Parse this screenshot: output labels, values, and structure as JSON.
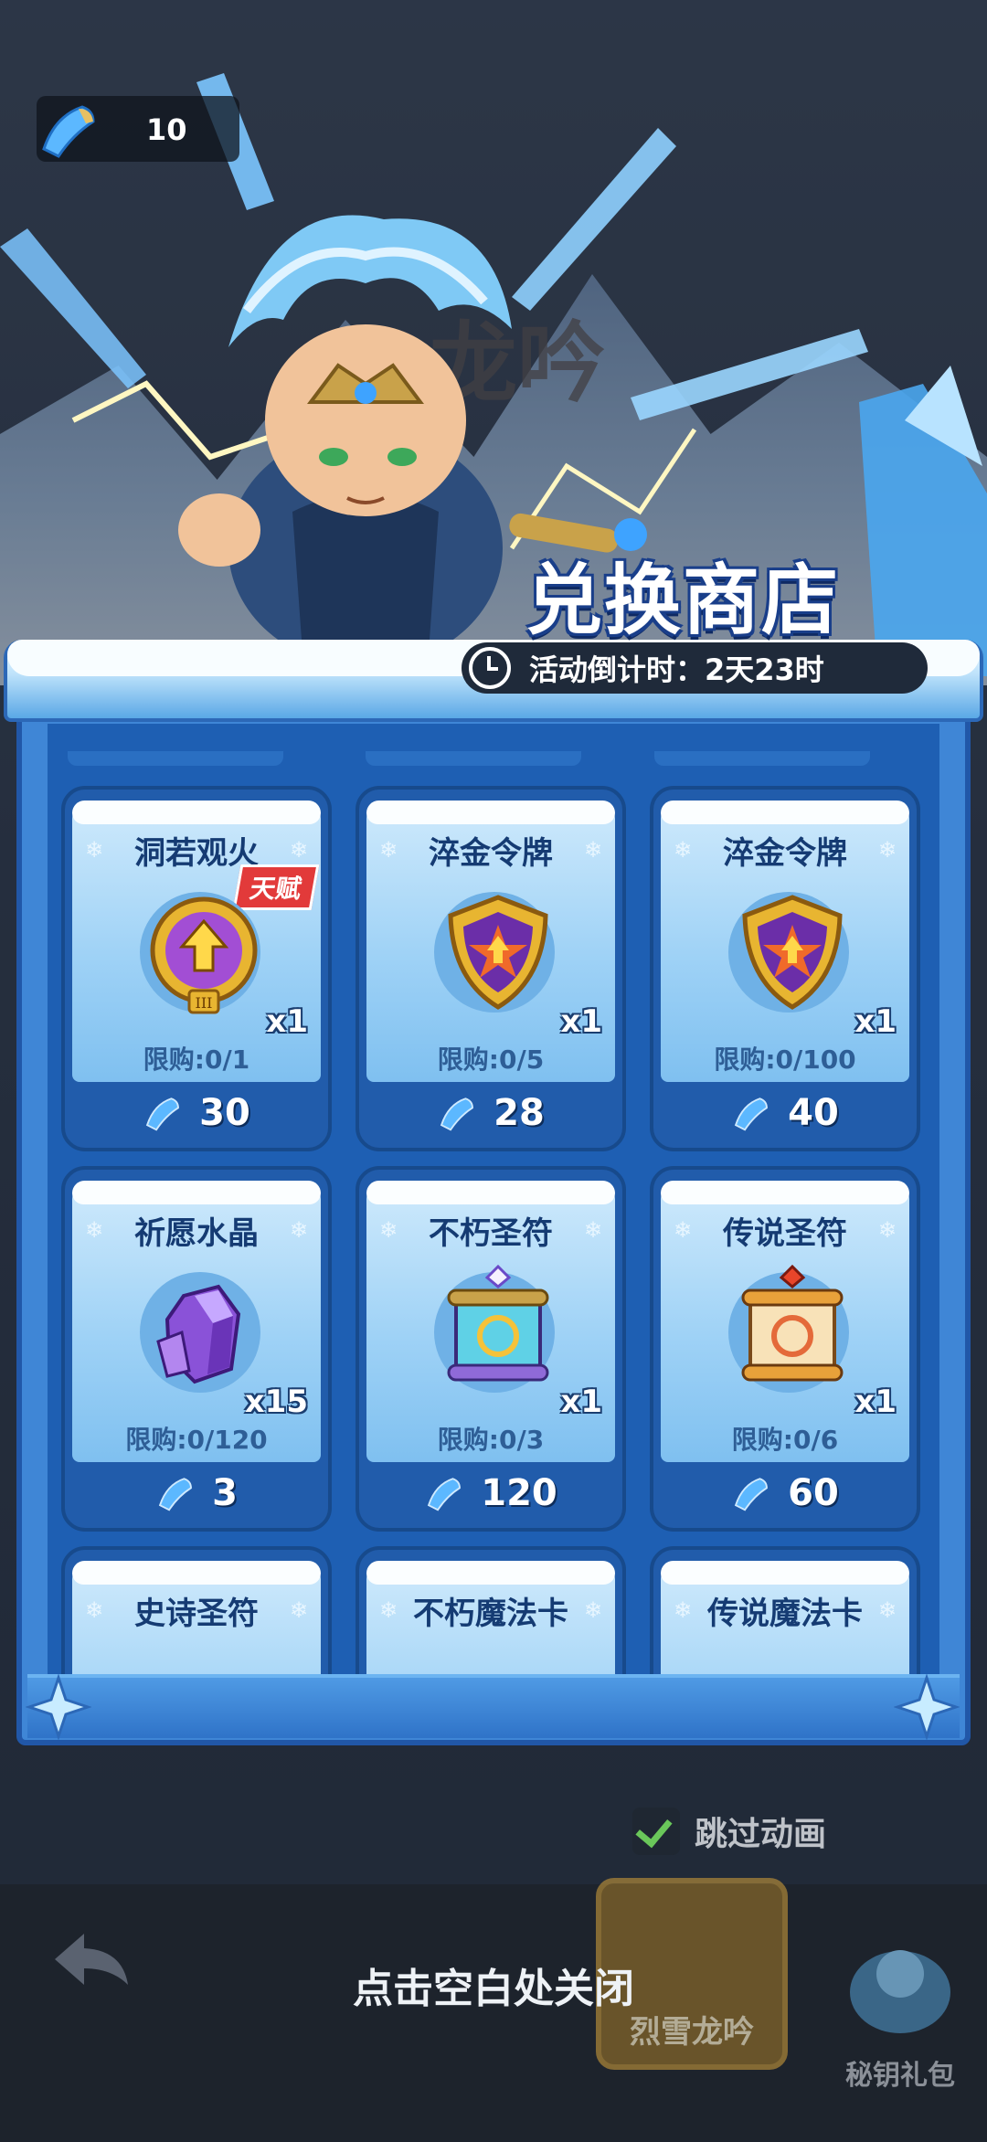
{
  "currency": {
    "amount": "10",
    "icon": "ice-crystal-icon"
  },
  "background": {
    "ghost_title": "龙吟"
  },
  "shop": {
    "title": "兑换商店",
    "countdown": "活动倒计时：2天23时"
  },
  "items": [
    {
      "name": "洞若观火",
      "badge": "天赋",
      "icon": "talent-upgrade-medal-icon",
      "qty": "x1",
      "limit": "限购:0/1",
      "price": "30"
    },
    {
      "name": "淬金令牌",
      "icon": "gold-token-shield-icon",
      "qty": "x1",
      "limit": "限购:0/5",
      "price": "28"
    },
    {
      "name": "淬金令牌",
      "icon": "gold-token-shield-icon",
      "qty": "x1",
      "limit": "限购:0/100",
      "price": "40"
    },
    {
      "name": "祈愿水晶",
      "icon": "wish-crystal-icon",
      "qty": "x15",
      "limit": "限购:0/120",
      "price": "3"
    },
    {
      "name": "不朽圣符",
      "icon": "immortal-rune-scroll-icon",
      "qty": "x1",
      "limit": "限购:0/3",
      "price": "120"
    },
    {
      "name": "传说圣符",
      "icon": "legend-rune-scroll-icon",
      "qty": "x1",
      "limit": "限购:0/6",
      "price": "60"
    },
    {
      "name": "史诗圣符",
      "icon": "epic-rune-scroll-icon"
    },
    {
      "name": "不朽魔法卡",
      "icon": "immortal-magic-card-icon"
    },
    {
      "name": "传说魔法卡",
      "icon": "legend-magic-card-icon"
    }
  ],
  "skip_animation": {
    "label": "跳过动画",
    "checked": true
  },
  "close_hint": "点击空白处关闭",
  "tabs": [
    {
      "label": "烈雪龙吟"
    },
    {
      "label": "秘钥礼包"
    }
  ],
  "colors": {
    "panel_blue": "#3f86d6",
    "card_light": "#cfeafc",
    "badge_red": "#e23a3a"
  }
}
